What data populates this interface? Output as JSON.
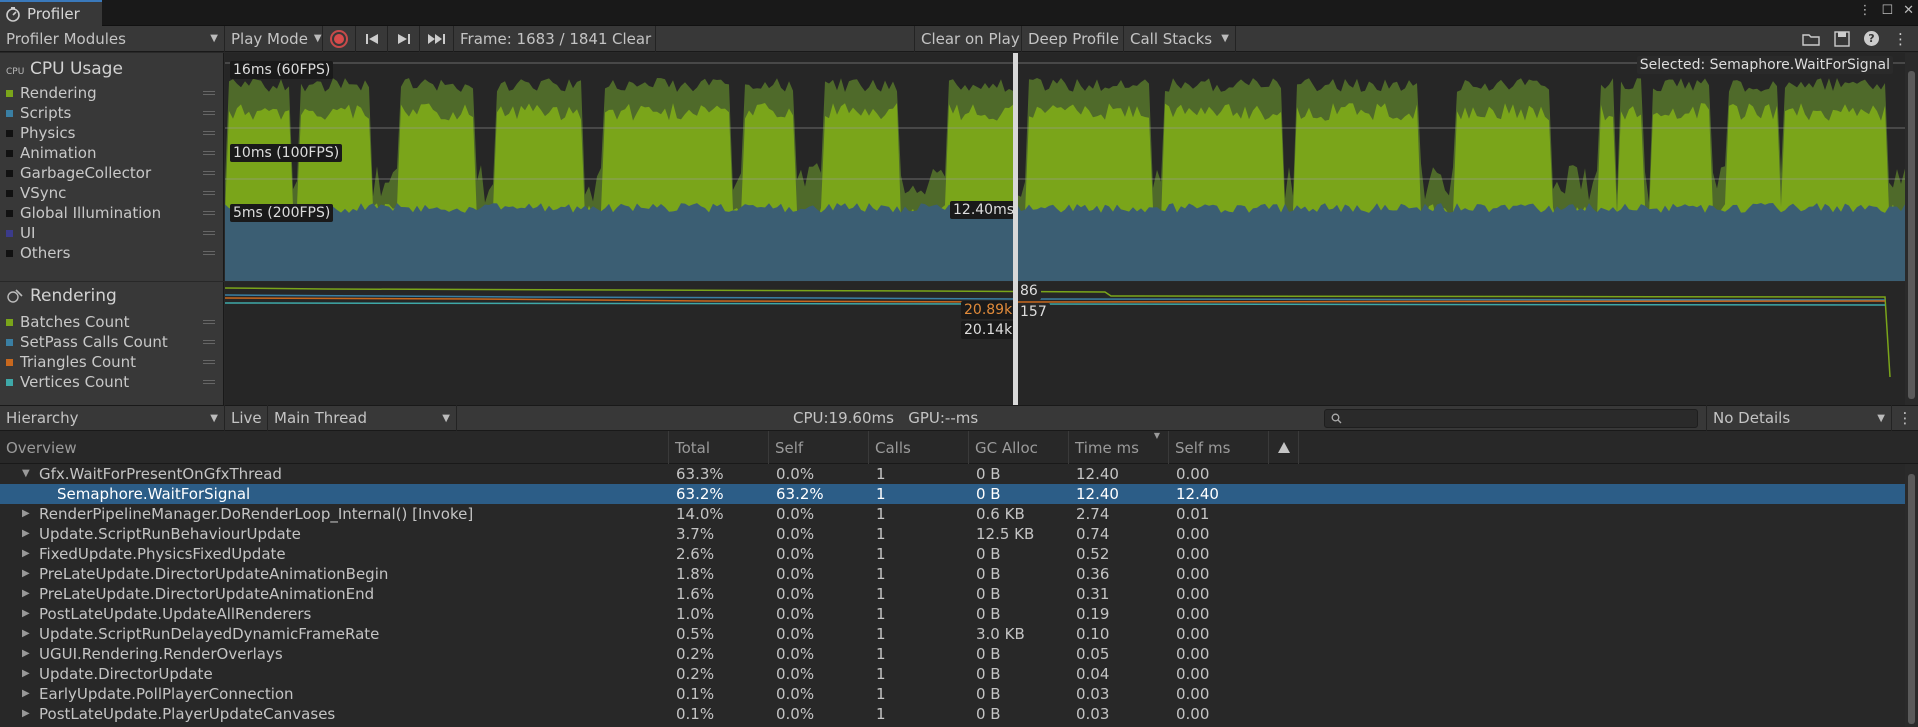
{
  "window": {
    "tab_title": "Profiler"
  },
  "toolbar": {
    "modules": "Profiler Modules",
    "play_mode": "Play Mode",
    "frame": "Frame: 1683 / 1841",
    "clear": "Clear",
    "clear_on_play": "Clear on Play",
    "deep_profile": "Deep Profile",
    "call_stacks": "Call Stacks"
  },
  "cpu": {
    "title": "CPU Usage",
    "legend": [
      {
        "label": "Rendering",
        "color": "#7aa51a"
      },
      {
        "label": "Scripts",
        "color": "#3a7fa3"
      },
      {
        "label": "Physics",
        "color": "#111111"
      },
      {
        "label": "Animation",
        "color": "#111111"
      },
      {
        "label": "GarbageCollector",
        "color": "#111111"
      },
      {
        "label": "VSync",
        "color": "#111111"
      },
      {
        "label": "Global Illumination",
        "color": "#111111"
      },
      {
        "label": "UI",
        "color": "#3b3b8a"
      },
      {
        "label": "Others",
        "color": "#111111"
      }
    ],
    "line_16": "16ms (60FPS)",
    "line_10": "10ms (100FPS)",
    "line_5": "5ms (200FPS)",
    "cursor_value": "12.40ms",
    "selected": "Selected: Semaphore.WaitForSignal"
  },
  "rendering": {
    "title": "Rendering",
    "legend": [
      {
        "label": "Batches Count",
        "color": "#7aa51a"
      },
      {
        "label": "SetPass Calls Count",
        "color": "#3a7fa3"
      },
      {
        "label": "Triangles Count",
        "color": "#c8681e"
      },
      {
        "label": "Vertices Count",
        "color": "#3ea8a8"
      }
    ],
    "val_86": "86",
    "val_157": "157",
    "val_tri": "20.89k",
    "val_vert": "20.14k"
  },
  "hierarchy_bar": {
    "view": "Hierarchy",
    "live": "Live",
    "thread": "Main Thread",
    "cpu_gpu": "CPU:19.60ms   GPU:--ms",
    "details": "No Details"
  },
  "columns": [
    "Overview",
    "Total",
    "Self",
    "Calls",
    "GC Alloc",
    "Time ms",
    "Self ms"
  ],
  "rows": [
    {
      "name": "Gfx.WaitForPresentOnGfxThread",
      "total": "63.3%",
      "self": "0.0%",
      "calls": "1",
      "gc": "0 B",
      "time": "12.40",
      "selfms": "0.00",
      "indent": 0,
      "expanded": true
    },
    {
      "name": "Semaphore.WaitForSignal",
      "total": "63.2%",
      "self": "63.2%",
      "calls": "1",
      "gc": "0 B",
      "time": "12.40",
      "selfms": "12.40",
      "indent": 1,
      "selected": true
    },
    {
      "name": "RenderPipelineManager.DoRenderLoop_Internal() [Invoke]",
      "total": "14.0%",
      "self": "0.0%",
      "calls": "1",
      "gc": "0.6 KB",
      "time": "2.74",
      "selfms": "0.01",
      "indent": 0
    },
    {
      "name": "Update.ScriptRunBehaviourUpdate",
      "total": "3.7%",
      "self": "0.0%",
      "calls": "1",
      "gc": "12.5 KB",
      "time": "0.74",
      "selfms": "0.00",
      "indent": 0
    },
    {
      "name": "FixedUpdate.PhysicsFixedUpdate",
      "total": "2.6%",
      "self": "0.0%",
      "calls": "1",
      "gc": "0 B",
      "time": "0.52",
      "selfms": "0.00",
      "indent": 0
    },
    {
      "name": "PreLateUpdate.DirectorUpdateAnimationBegin",
      "total": "1.8%",
      "self": "0.0%",
      "calls": "1",
      "gc": "0 B",
      "time": "0.36",
      "selfms": "0.00",
      "indent": 0
    },
    {
      "name": "PreLateUpdate.DirectorUpdateAnimationEnd",
      "total": "1.6%",
      "self": "0.0%",
      "calls": "1",
      "gc": "0 B",
      "time": "0.31",
      "selfms": "0.00",
      "indent": 0
    },
    {
      "name": "PostLateUpdate.UpdateAllRenderers",
      "total": "1.0%",
      "self": "0.0%",
      "calls": "1",
      "gc": "0 B",
      "time": "0.19",
      "selfms": "0.00",
      "indent": 0
    },
    {
      "name": "Update.ScriptRunDelayedDynamicFrameRate",
      "total": "0.5%",
      "self": "0.0%",
      "calls": "1",
      "gc": "3.0 KB",
      "time": "0.10",
      "selfms": "0.00",
      "indent": 0
    },
    {
      "name": "UGUI.Rendering.RenderOverlays",
      "total": "0.2%",
      "self": "0.0%",
      "calls": "1",
      "gc": "0 B",
      "time": "0.05",
      "selfms": "0.00",
      "indent": 0
    },
    {
      "name": "Update.DirectorUpdate",
      "total": "0.2%",
      "self": "0.0%",
      "calls": "1",
      "gc": "0 B",
      "time": "0.04",
      "selfms": "0.00",
      "indent": 0
    },
    {
      "name": "EarlyUpdate.PollPlayerConnection",
      "total": "0.1%",
      "self": "0.0%",
      "calls": "1",
      "gc": "0 B",
      "time": "0.03",
      "selfms": "0.00",
      "indent": 0
    },
    {
      "name": "PostLateUpdate.PlayerUpdateCanvases",
      "total": "0.1%",
      "self": "0.0%",
      "calls": "1",
      "gc": "0 B",
      "time": "0.03",
      "selfms": "0.00",
      "indent": 0
    }
  ]
}
